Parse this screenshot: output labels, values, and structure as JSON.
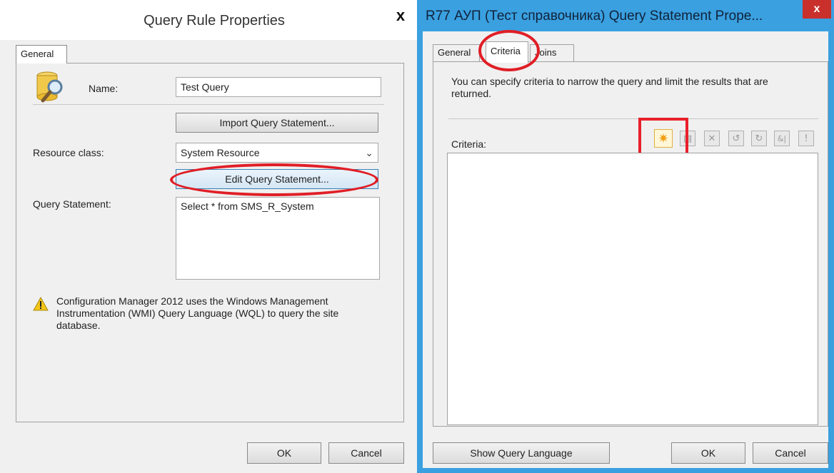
{
  "left_dialog": {
    "title": "Query Rule Properties",
    "close_glyph": "x",
    "tab_general": "General",
    "name_label": "Name:",
    "name_value": "Test Query",
    "import_button": "Import Query Statement...",
    "resource_class_label": "Resource class:",
    "resource_class_value": "System Resource",
    "edit_button": "Edit Query Statement...",
    "query_statement_label": "Query Statement:",
    "query_statement_value": "Select * from SMS_R_System",
    "warning_text": "Configuration Manager 2012 uses the Windows Management Instrumentation (WMI) Query Language (WQL) to query the site database.",
    "ok_button": "OK",
    "cancel_button": "Cancel"
  },
  "right_dialog": {
    "title": "R77 АУП (Тест справочника) Query Statement Prope...",
    "close_glyph": "x",
    "tabs": [
      "General",
      "Criteria",
      "Joins"
    ],
    "description": "You can specify criteria to narrow the query and limit the results that are returned.",
    "criteria_label": "Criteria:",
    "toolbar_glyphs": [
      "✷",
      "▤",
      "✕",
      "↺",
      "↻",
      "&|",
      "!"
    ],
    "show_query_language_button": "Show Query Language",
    "ok_button": "OK",
    "cancel_button": "Cancel"
  },
  "colors": {
    "dialog_bg": "#f0f0f0",
    "title_bar_right": "#3aa0e0",
    "close_button_red": "#c9302c",
    "annotation_red": "#e01e26"
  }
}
